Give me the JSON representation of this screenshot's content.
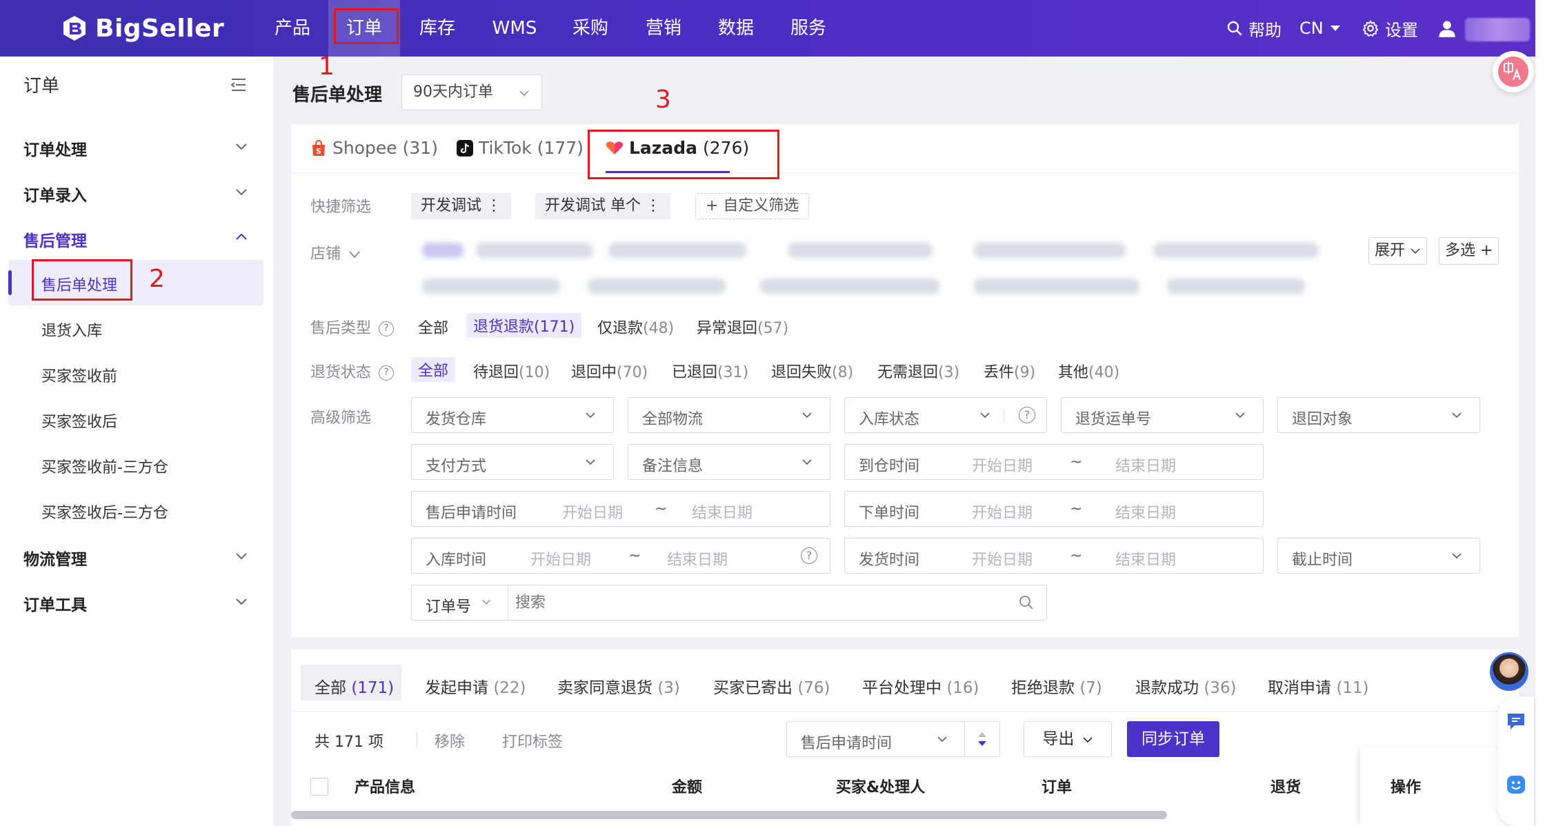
{
  "nav": {
    "brand": "BigSeller",
    "items": [
      "产品",
      "订单",
      "库存",
      "WMS",
      "采购",
      "营销",
      "数据",
      "服务"
    ],
    "help": "帮助",
    "lang": "CN",
    "settings": "设置",
    "colors": {
      "bar": "#4c2dc4",
      "accent": "#4b32c8",
      "annotation": "#e0191f"
    }
  },
  "sidebar": {
    "title": "订单",
    "groups": [
      {
        "label": "订单处理"
      },
      {
        "label": "订单录入"
      },
      {
        "label": "售后管理"
      },
      {
        "label": "物流管理"
      },
      {
        "label": "订单工具"
      }
    ],
    "after_sales_items": [
      "售后单处理",
      "退货入库",
      "买家签收前",
      "买家签收后",
      "买家签收前-三方仓",
      "买家签收后-三方仓"
    ]
  },
  "annotations": [
    "1",
    "2",
    "3"
  ],
  "main": {
    "title": "售后单处理",
    "range": "90天内订单",
    "platform_tabs": [
      {
        "name": "Shopee",
        "count": "(31)"
      },
      {
        "name": "TikTok",
        "count": "(177)"
      },
      {
        "name": "Lazada",
        "count": "(276)"
      }
    ],
    "quick_filter": {
      "label": "快捷筛选",
      "chips": [
        "开发调试 ⋮",
        "开发调试 单个 ⋮"
      ],
      "custom": "+ 自定义筛选"
    },
    "store": {
      "label": "店铺",
      "expand": "展开",
      "multi": "多选 +"
    },
    "after_type": {
      "label": "售后类型",
      "options": [
        {
          "name": "全部",
          "count": ""
        },
        {
          "name": "退货退款",
          "count": "(171)"
        },
        {
          "name": "仅退款",
          "count": "(48)"
        },
        {
          "name": "异常退回",
          "count": "(57)"
        }
      ]
    },
    "return_status": {
      "label": "退货状态",
      "options": [
        {
          "name": "全部",
          "count": ""
        },
        {
          "name": "待退回",
          "count": "(10)"
        },
        {
          "name": "退回中",
          "count": "(70)"
        },
        {
          "name": "已退回",
          "count": "(31)"
        },
        {
          "name": "退回失败",
          "count": "(8)"
        },
        {
          "name": "无需退回",
          "count": "(3)"
        },
        {
          "name": "丢件",
          "count": "(9)"
        },
        {
          "name": "其他",
          "count": "(40)"
        }
      ]
    },
    "advanced": {
      "label": "高级筛选",
      "warehouse": "发货仓库",
      "logistics": "全部物流",
      "inbound_status": "入库状态",
      "return_tracking": "退货运单号",
      "return_target": "退回对象",
      "payment": "支付方式",
      "remark": "备注信息",
      "arrive_time": "到仓时间",
      "apply_time": "售后申请时间",
      "order_time": "下单时间",
      "inbound_time": "入库时间",
      "ship_time": "发货时间",
      "deadline": "截止时间",
      "start": "开始日期",
      "end": "结束日期",
      "tilde": "~",
      "order_no": "订单号",
      "search_placeholder": "搜索"
    }
  },
  "list": {
    "status_tabs": [
      {
        "name": "全部",
        "count": "(171)"
      },
      {
        "name": "发起申请",
        "count": "(22)"
      },
      {
        "name": "卖家同意退货",
        "count": "(3)"
      },
      {
        "name": "买家已寄出",
        "count": "(76)"
      },
      {
        "name": "平台处理中",
        "count": "(16)"
      },
      {
        "name": "拒绝退款",
        "count": "(7)"
      },
      {
        "name": "退款成功",
        "count": "(36)"
      },
      {
        "name": "取消申请",
        "count": "(11)"
      }
    ],
    "total": "共 171 项",
    "remove": "移除",
    "print_label": "打印标签",
    "sort_field": "售后申请时间",
    "export": "导出",
    "sync": "同步订单",
    "columns": [
      "产品信息",
      "金额",
      "买家&处理人",
      "订单",
      "退货",
      "操作"
    ]
  }
}
